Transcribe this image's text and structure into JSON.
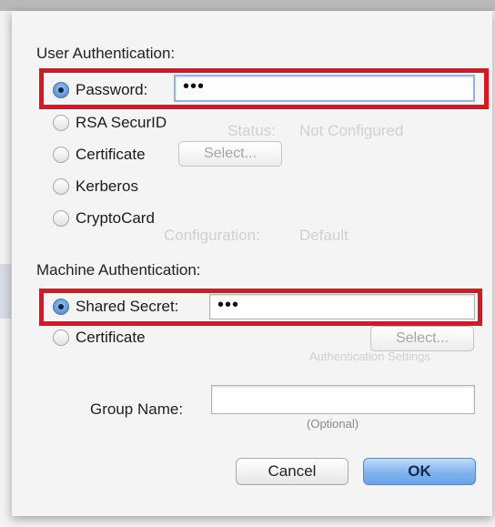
{
  "background": {
    "ghost_texts": [
      "Status:",
      "Not Configured",
      "Configuration:",
      "Default",
      "Authentication Settings"
    ]
  },
  "user_auth": {
    "heading": "User Authentication:",
    "options": [
      {
        "label": "Password:",
        "selected": true
      },
      {
        "label": "RSA SecurID",
        "selected": false
      },
      {
        "label": "Certificate",
        "selected": false
      },
      {
        "label": "Kerberos",
        "selected": false
      },
      {
        "label": "CryptoCard",
        "selected": false
      }
    ],
    "password_value": "•••",
    "certificate_select_label": "Select..."
  },
  "machine_auth": {
    "heading": "Machine Authentication:",
    "options": [
      {
        "label": "Shared Secret:",
        "selected": true
      },
      {
        "label": "Certificate",
        "selected": false
      }
    ],
    "shared_secret_value": "•••",
    "certificate_select_label": "Select..."
  },
  "group": {
    "label": "Group Name:",
    "value": "",
    "hint": "(Optional)"
  },
  "buttons": {
    "cancel": "Cancel",
    "ok": "OK"
  },
  "colors": {
    "highlight": "#e0141f",
    "ok_button": "#7fb3ec"
  }
}
